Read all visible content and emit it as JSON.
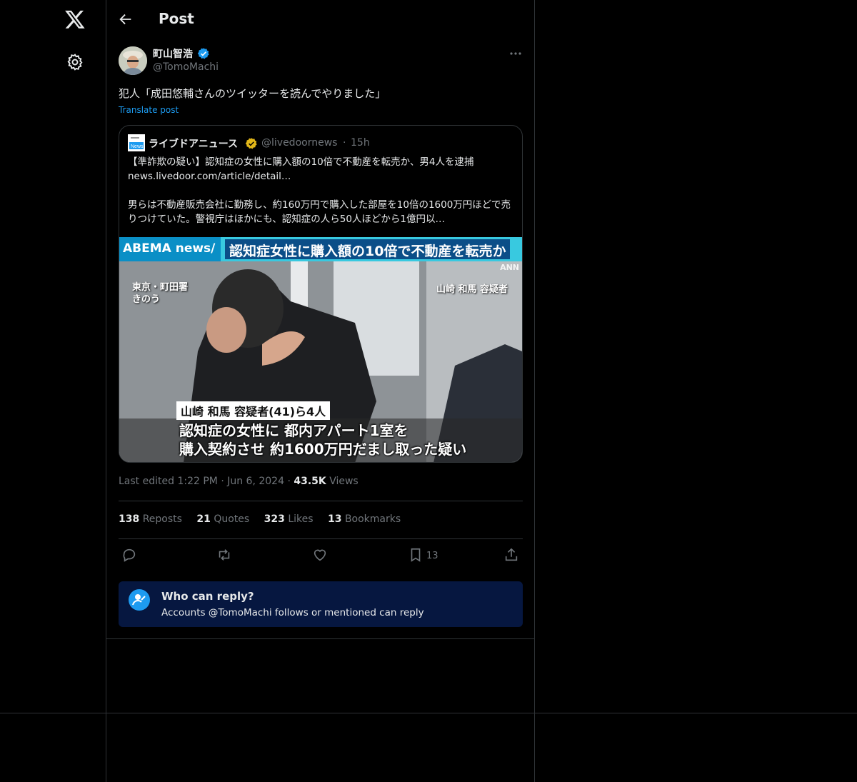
{
  "header": {
    "title": "Post"
  },
  "author": {
    "display_name": "町山智浩",
    "handle": "@TomoMachi"
  },
  "post": {
    "text": "犯人「成田悠輔さんのツイッターを読んでやりました」",
    "translate_label": "Translate post"
  },
  "quote": {
    "name": "ライブドアニュース",
    "handle": "@livedoornews",
    "separator": "·",
    "time": "15h",
    "logo_text": "News",
    "text": "【準詐欺の疑い】認知症の女性に購入額の10倍で不動産を転売か、男4人を逮捕\nnews.livedoor.com/article/detail…\n\n男らは不動産販売会社に勤務し、約160万円で購入した部屋を10倍の1600万円ほどで売りつけていた。警視庁はほかにも、認知症の人ら50人ほどから1億円以…",
    "image": {
      "brand": "ABEMA news/",
      "headline": "認知症女性に購入額の10倍で不動産を転売か",
      "watermark": "ANN",
      "location": "東京・町田署\nきのう",
      "suspect_label": "山崎 和馬 容疑者",
      "caption_name": "山崎 和馬 容疑者(41)ら4人",
      "caption_body": "認知症の女性に 都内アパート1室を\n購入契約させ 約1600万円だまし取った疑い"
    }
  },
  "meta": {
    "edited": "Last edited 1:22 PM",
    "sep1": "·",
    "date": "Jun 6, 2024",
    "sep2": "·",
    "views_count": "43.5K",
    "views_label": "Views"
  },
  "stats": [
    {
      "count": "138",
      "label": "Reposts"
    },
    {
      "count": "21",
      "label": "Quotes"
    },
    {
      "count": "323",
      "label": "Likes"
    },
    {
      "count": "13",
      "label": "Bookmarks"
    }
  ],
  "actions": {
    "bookmark_count": "13"
  },
  "reply_settings": {
    "title": "Who can reply?",
    "subtitle": "Accounts @TomoMachi follows or mentioned can reply"
  },
  "colors": {
    "accent": "#1d9bf0",
    "background": "#000000",
    "border": "#2f3336",
    "muted": "#71767b",
    "notice_bg": "#061740"
  }
}
